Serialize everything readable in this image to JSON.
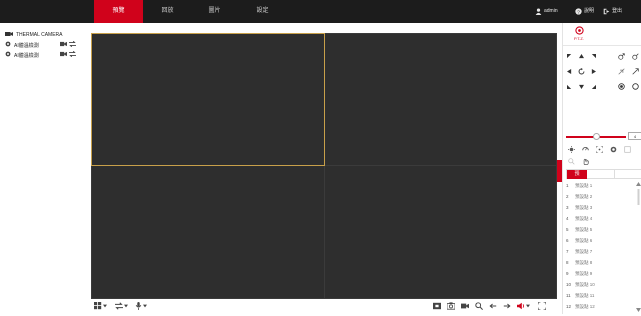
{
  "nav": {
    "tabs": [
      {
        "label": "預覽",
        "active": true
      },
      {
        "label": "回放",
        "active": false
      },
      {
        "label": "圖片",
        "active": false
      },
      {
        "label": "設定",
        "active": false
      }
    ],
    "user": "admin",
    "help": "說明",
    "logout": "登出"
  },
  "tree": {
    "root": "THERMAL CAMERA",
    "channels": [
      {
        "label": "AI體溫檢測"
      },
      {
        "label": "AI體溫檢測"
      }
    ]
  },
  "grid": {
    "layout": "2x2",
    "selected_cell": 0
  },
  "ptz": {
    "title": "P.T.Z.",
    "speed_value": "4",
    "tab_label": "預",
    "presets": [
      {
        "num": "1",
        "name": "預設點 1"
      },
      {
        "num": "2",
        "name": "預設點 2"
      },
      {
        "num": "3",
        "name": "預設點 3"
      },
      {
        "num": "4",
        "name": "預設點 4"
      },
      {
        "num": "5",
        "name": "預設點 5"
      },
      {
        "num": "6",
        "name": "預設點 6"
      },
      {
        "num": "7",
        "name": "預設點 7"
      },
      {
        "num": "8",
        "name": "預設點 8"
      },
      {
        "num": "9",
        "name": "預設點 9"
      },
      {
        "num": "10",
        "name": "預設點 10"
      },
      {
        "num": "11",
        "name": "預設點 11"
      },
      {
        "num": "12",
        "name": "預設點 12"
      }
    ]
  },
  "colors": {
    "accent": "#d0021b",
    "topbar": "#1c1c1c",
    "video_bg": "#2e2e2e",
    "selection": "#c8a04a"
  }
}
